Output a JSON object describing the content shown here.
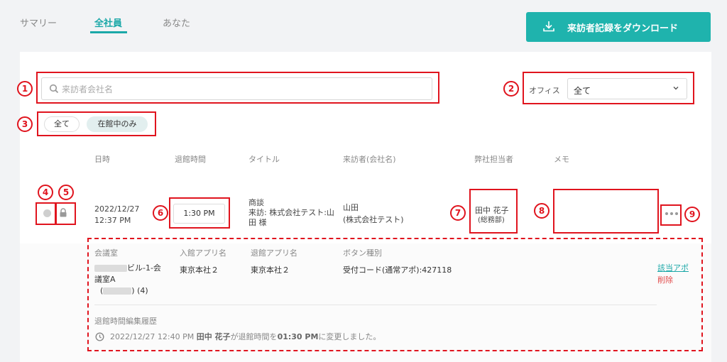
{
  "tabs": [
    {
      "label": "サマリー",
      "active": false
    },
    {
      "label": "全社員",
      "active": true
    },
    {
      "label": "あなた",
      "active": false
    }
  ],
  "download_button": {
    "label": "来訪者記録をダウンロード",
    "icon": "download-icon"
  },
  "search": {
    "placeholder": "来訪者会社名",
    "icon": "search-icon"
  },
  "office": {
    "label": "オフィス",
    "selected": "全て",
    "icon": "chevron-down-icon"
  },
  "filters": [
    {
      "label": "全て",
      "selected": false
    },
    {
      "label": "在館中のみ",
      "selected": true
    }
  ],
  "table": {
    "headers": {
      "date": "日時",
      "checkout": "退館時間",
      "title": "タイトル",
      "visitor": "来訪者(会社名)",
      "host": "弊社担当者",
      "memo": "メモ"
    },
    "row": {
      "status_icon": "status-dot-icon",
      "lock_icon": "lock-icon",
      "date": "2022/12/27",
      "time": "12:37 PM",
      "checkout_time": "1:30 PM",
      "title_line1": "商談",
      "title_line2": "来訪: 株式会社テスト:山",
      "title_line3": "田 様",
      "visitor_name": "山田",
      "visitor_company": "(株式会社テスト)",
      "host_name": "田中 花子",
      "host_dept": "(総務部)",
      "memo": "",
      "more_icon": "more-horizontal-icon"
    }
  },
  "detail": {
    "headers": {
      "room": "会議室",
      "checkin_app": "入館アプリ名",
      "checkout_app": "退館アプリ名",
      "button_type": "ボタン種別"
    },
    "room_line1": "ビル-1-会",
    "room_line2": "議室A",
    "room_open": "(",
    "room_close": ") (4)",
    "checkin_app": "東京本社２",
    "checkout_app": "東京本社２",
    "button_type": "受付コード(通常アポ):427118",
    "link_appointment": "該当アポ",
    "link_delete": "削除",
    "history_title": "退館時間編集履歴",
    "history_time": "2022/12/27 12:40 PM",
    "history_user": "田中 花子",
    "history_mid": "が退館時間を",
    "history_value": "01:30 PM",
    "history_end": "に変更しました。",
    "history_icon": "clock-icon"
  },
  "annotations": [
    "1",
    "2",
    "3",
    "4",
    "5",
    "6",
    "7",
    "8",
    "9"
  ],
  "colors": {
    "accent": "#1fb3ad",
    "annotation": "#e0141e",
    "danger": "#e24a4a"
  }
}
